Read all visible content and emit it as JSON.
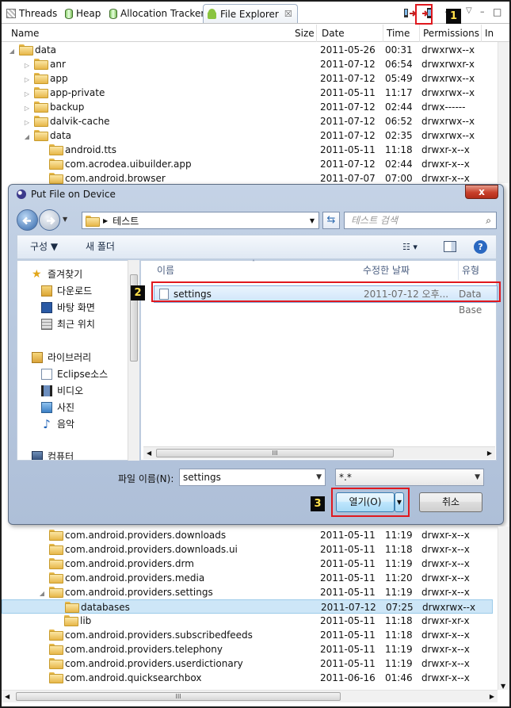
{
  "tabs": [
    {
      "label": "Threads",
      "icon": "threads-icon"
    },
    {
      "label": "Heap",
      "icon": "heap-cylinder-icon"
    },
    {
      "label": "Allocation Tracker",
      "icon": "allocation-cylinder-icon"
    },
    {
      "label": "File Explorer",
      "icon": "android-icon",
      "active": true
    }
  ],
  "columns": {
    "name": "Name",
    "size": "Size",
    "date": "Date",
    "time": "Time",
    "permissions": "Permissions",
    "info": "In"
  },
  "rows_top": [
    {
      "name": "data",
      "date": "2011-05-26",
      "time": "00:31",
      "perm": "drwxrwx--x",
      "level": 0,
      "expanded": true
    },
    {
      "name": "anr",
      "date": "2011-07-12",
      "time": "06:54",
      "perm": "drwxrwxr-x",
      "level": 1
    },
    {
      "name": "app",
      "date": "2011-07-12",
      "time": "05:49",
      "perm": "drwxrwx--x",
      "level": 1
    },
    {
      "name": "app-private",
      "date": "2011-05-11",
      "time": "11:17",
      "perm": "drwxrwx--x",
      "level": 1
    },
    {
      "name": "backup",
      "date": "2011-07-12",
      "time": "02:44",
      "perm": "drwx------",
      "level": 1
    },
    {
      "name": "dalvik-cache",
      "date": "2011-07-12",
      "time": "06:52",
      "perm": "drwxrwx--x",
      "level": 1
    },
    {
      "name": "data",
      "date": "2011-07-12",
      "time": "02:35",
      "perm": "drwxrwx--x",
      "level": 1,
      "expanded": true
    },
    {
      "name": "android.tts",
      "date": "2011-05-11",
      "time": "11:18",
      "perm": "drwxr-x--x",
      "level": 2
    },
    {
      "name": "com.acrodea.uibuilder.app",
      "date": "2011-07-12",
      "time": "02:44",
      "perm": "drwxr-x--x",
      "level": 2
    },
    {
      "name": "com.android.browser",
      "date": "2011-07-07",
      "time": "07:00",
      "perm": "drwxr-x--x",
      "level": 2
    }
  ],
  "rows_bottom": [
    {
      "name": "com.android.providers.downloads",
      "date": "2011-05-11",
      "time": "11:19",
      "perm": "drwxr-x--x",
      "level": 2
    },
    {
      "name": "com.android.providers.downloads.ui",
      "date": "2011-05-11",
      "time": "11:18",
      "perm": "drwxr-x--x",
      "level": 2
    },
    {
      "name": "com.android.providers.drm",
      "date": "2011-05-11",
      "time": "11:19",
      "perm": "drwxr-x--x",
      "level": 2
    },
    {
      "name": "com.android.providers.media",
      "date": "2011-05-11",
      "time": "11:20",
      "perm": "drwxr-x--x",
      "level": 2
    },
    {
      "name": "com.android.providers.settings",
      "date": "2011-05-11",
      "time": "11:19",
      "perm": "drwxr-x--x",
      "level": 2,
      "expanded": true
    },
    {
      "name": "databases",
      "date": "2011-07-12",
      "time": "07:25",
      "perm": "drwxrwx--x",
      "level": 3,
      "selected": true
    },
    {
      "name": "lib",
      "date": "2011-05-11",
      "time": "11:18",
      "perm": "drwxr-xr-x",
      "level": 3
    },
    {
      "name": "com.android.providers.subscribedfeeds",
      "date": "2011-05-11",
      "time": "11:18",
      "perm": "drwxr-x--x",
      "level": 2
    },
    {
      "name": "com.android.providers.telephony",
      "date": "2011-05-11",
      "time": "11:19",
      "perm": "drwxr-x--x",
      "level": 2
    },
    {
      "name": "com.android.providers.userdictionary",
      "date": "2011-05-11",
      "time": "11:19",
      "perm": "drwxr-x--x",
      "level": 2
    },
    {
      "name": "com.android.quicksearchbox",
      "date": "2011-06-16",
      "time": "01:46",
      "perm": "drwxr-x--x",
      "level": 2
    }
  ],
  "markers": {
    "one": "1",
    "two": "2",
    "three": "3"
  },
  "dialog": {
    "title": "Put File on Device",
    "close": "x",
    "path": "테스트",
    "search_placeholder": "테스트 검색",
    "organize": "구성 ▼",
    "new_folder": "새 폴더",
    "nav": {
      "favorites": "즐겨찾기",
      "downloads": "다운로드",
      "desktop": "바탕 화면",
      "recent": "최근 위치",
      "libraries": "라이브러리",
      "eclipse": "Eclipse소스",
      "video": "비디오",
      "pictures": "사진",
      "music": "음악",
      "computer": "컴퓨터"
    },
    "file_headers": {
      "name": "이름",
      "modified": "수정한 날짜",
      "type": "유형"
    },
    "file": {
      "name": "settings",
      "modified": "2011-07-12 오후...",
      "type": "Data Base"
    },
    "filename_label": "파일 이름(N):",
    "filename_value": "settings",
    "filter_value": "*.*",
    "open_button": "열기(O)",
    "cancel_button": "취소",
    "hscroll_glyph": "III"
  }
}
